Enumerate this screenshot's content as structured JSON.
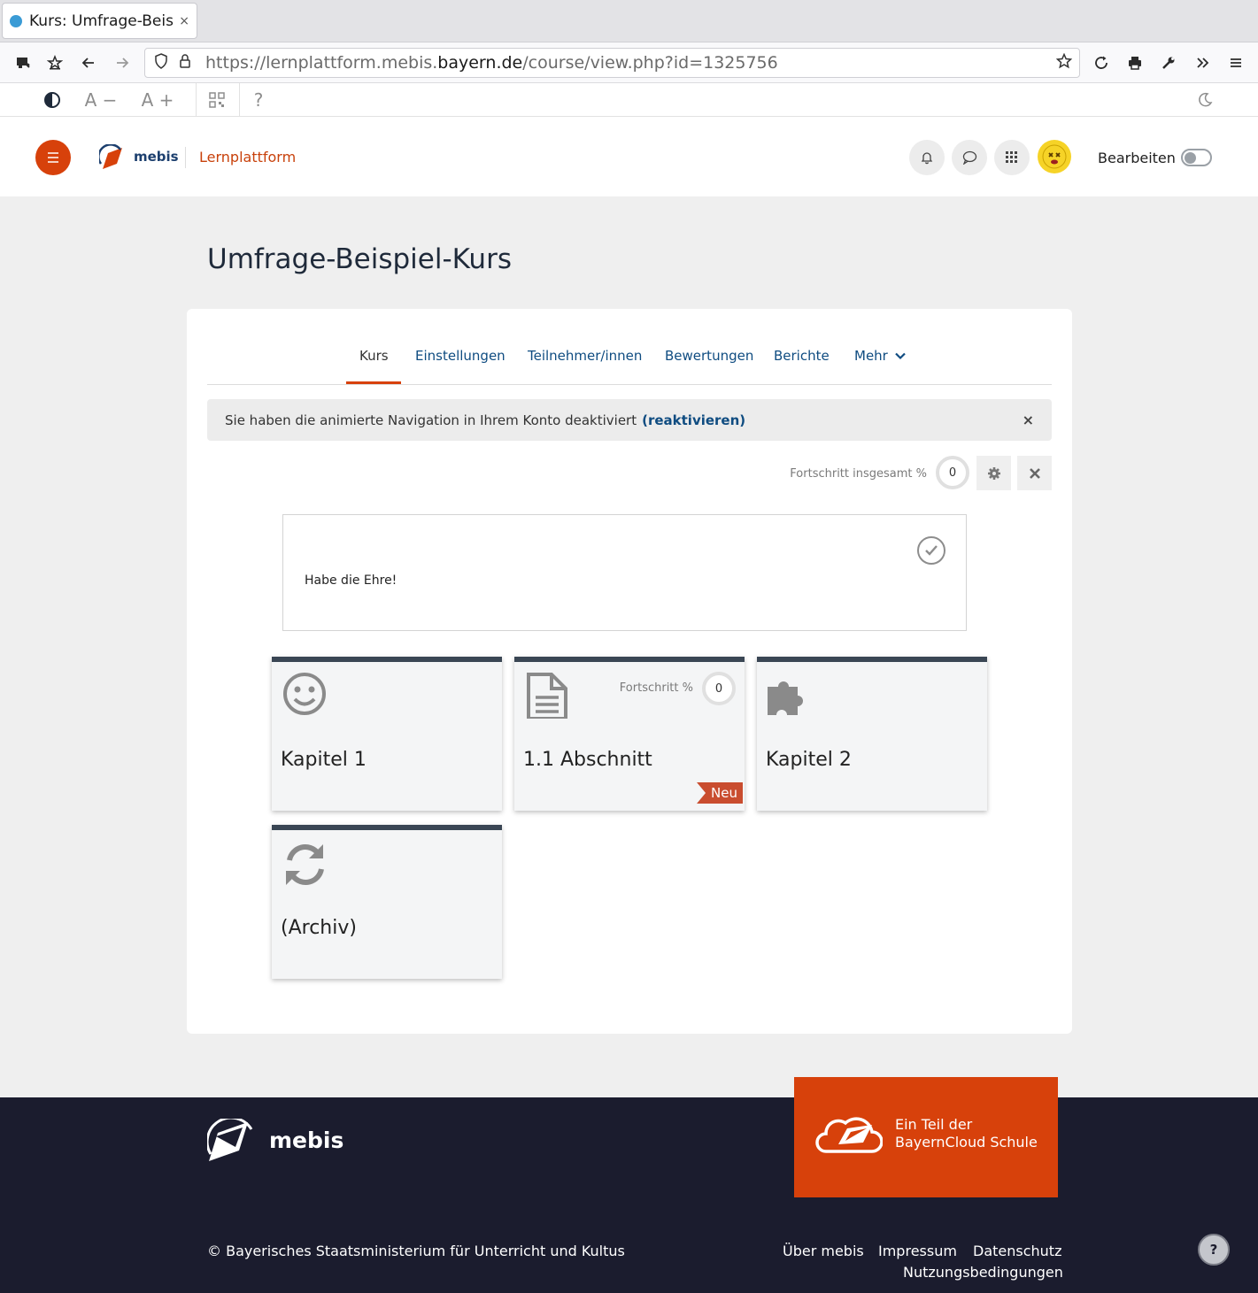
{
  "browser": {
    "tab_title": "Kurs: Umfrage-Beispiel-Kurs",
    "tab_close": "×",
    "url_prefix": "https://lernplattform.mebis.",
    "url_domain": "bayern.de",
    "url_suffix": "/course/view.php?id=1325756"
  },
  "a11y": {
    "font_decrease": "A −",
    "font_increase": "A +",
    "help": "?"
  },
  "header": {
    "logo_text": "mebis",
    "platform": "Lernplattform",
    "edit_label": "Bearbeiten",
    "edit_mode_on": false
  },
  "course": {
    "title": "Umfrage-Beispiel-Kurs"
  },
  "nav_tabs": [
    {
      "label": "Kurs",
      "active": true
    },
    {
      "label": "Einstellungen",
      "active": false
    },
    {
      "label": "Teilnehmer/innen",
      "active": false
    },
    {
      "label": "Bewertungen",
      "active": false
    },
    {
      "label": "Berichte",
      "active": false
    },
    {
      "label": "Mehr",
      "active": false
    }
  ],
  "alert": {
    "text": "Sie haben die animierte Navigation in Ihrem Konto deaktiviert",
    "link": "(reaktivieren)",
    "close": "×"
  },
  "progress": {
    "label": "Fortschritt insgesamt %",
    "value": "0",
    "value_percent": 0
  },
  "welcome": {
    "text": "Habe die Ehre!"
  },
  "tiles": [
    {
      "title": "Kapitel 1",
      "icon": "smiley-icon"
    },
    {
      "title": "1.1 Abschnitt",
      "icon": "document-icon",
      "progress_label": "Fortschritt %",
      "progress_value": "0",
      "badge": "Neu"
    },
    {
      "title": "Kapitel 2",
      "icon": "puzzle-icon"
    },
    {
      "title": "(Archiv)",
      "icon": "refresh-icon"
    }
  ],
  "footer": {
    "logo_text": "mebis",
    "cloud_line1": "Ein Teil der",
    "cloud_line2": "BayernCloud Schule",
    "copyright": "© Bayerisches Staatsministerium für Unterricht und Kultus",
    "links": [
      "Über mebis",
      "Impressum",
      "Datenschutz",
      "Nutzungsbedingungen"
    ],
    "help": "?"
  },
  "colors": {
    "accent": "#d7410b",
    "link": "#0f4c81",
    "tile_top": "#3a4654",
    "footer_bg": "#1b1c2e",
    "badge": "#c94d2f"
  }
}
